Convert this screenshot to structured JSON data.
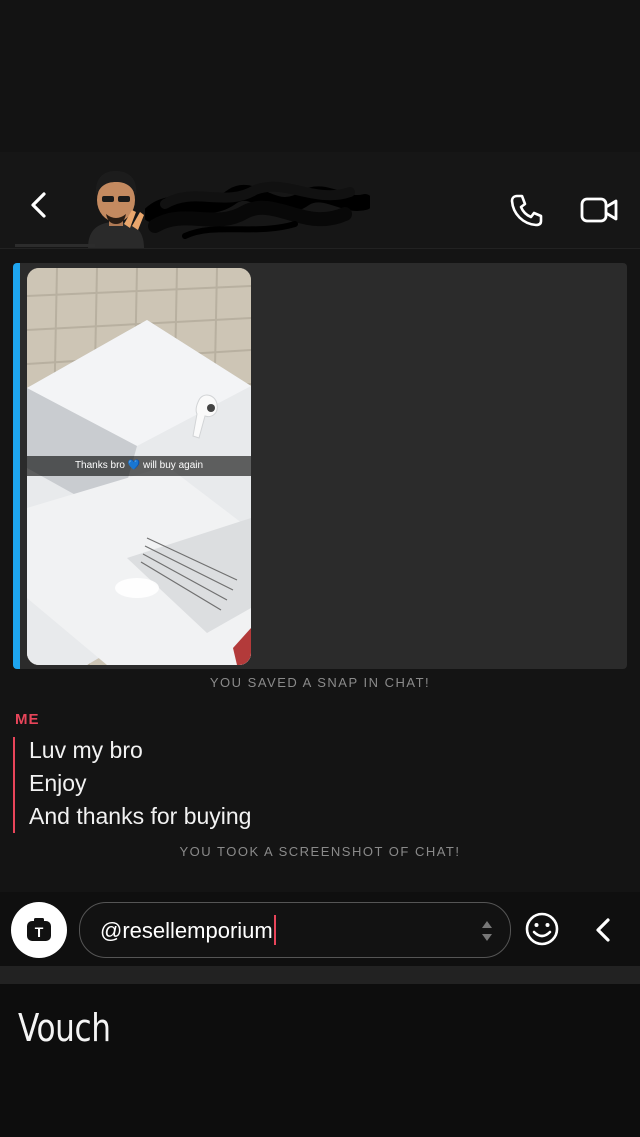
{
  "header": {
    "icons": {
      "back": "chevron-left-icon",
      "call": "phone-icon",
      "video": "video-camera-icon"
    }
  },
  "snap": {
    "overlay_caption_before": "Thanks bro",
    "overlay_caption_emoji": "💙",
    "overlay_caption_after": "will buy again",
    "saved_note": "YOU SAVED A SNAP IN CHAT!",
    "accent_color": "#1ea5f0"
  },
  "messages": {
    "sender": "ME",
    "sender_color": "#e8455a",
    "lines": [
      "Luv my bro",
      "Enjoy",
      "And thanks for buying"
    ],
    "screenshot_note": "YOU TOOK A SCREENSHOT OF CHAT!"
  },
  "composer": {
    "camera_icon_letter": "T",
    "input_value": "@resellemporium",
    "icons": {
      "emoji": "smiley-icon",
      "collapse": "chevron-left-icon"
    }
  },
  "post": {
    "caption": "Vouch"
  }
}
